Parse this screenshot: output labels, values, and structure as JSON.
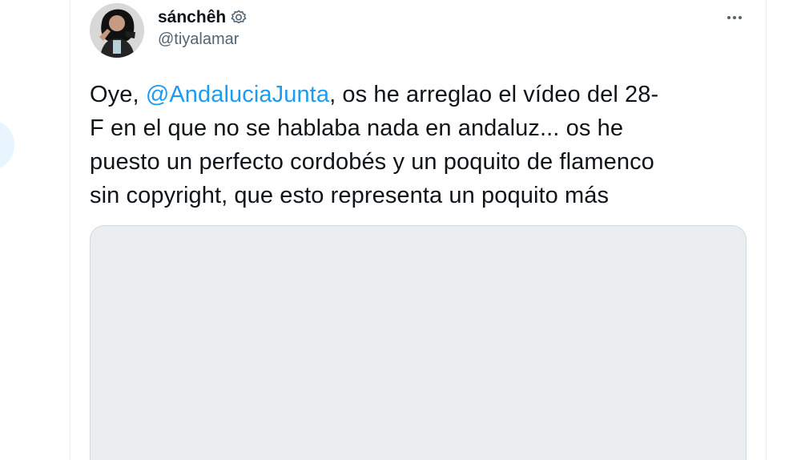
{
  "author": {
    "display_name": "sánchêh",
    "handle": "@tiyalamar",
    "badge_icon": "settings-badge-icon",
    "avatar_icon": "profile-avatar"
  },
  "tweet": {
    "text_parts": {
      "line1_prefix": "Oye, ",
      "mention": "@AndaluciaJunta",
      "line1_suffix": ", os he arreglao el vídeo del 28-",
      "line2": "F en el que no se hablaba nada en andaluz... os he",
      "line3": "puesto un perfecto cordobés y un poquito de flamenco",
      "line4": "sin copyright, que esto representa un poquito más"
    }
  },
  "controls": {
    "more_icon": "more-horizontal-icon"
  },
  "colors": {
    "text": "#0f1419",
    "secondary_text": "#536471",
    "link": "#1d9bf0",
    "border": "#cfd9de",
    "media_background": "#ebeef0"
  }
}
